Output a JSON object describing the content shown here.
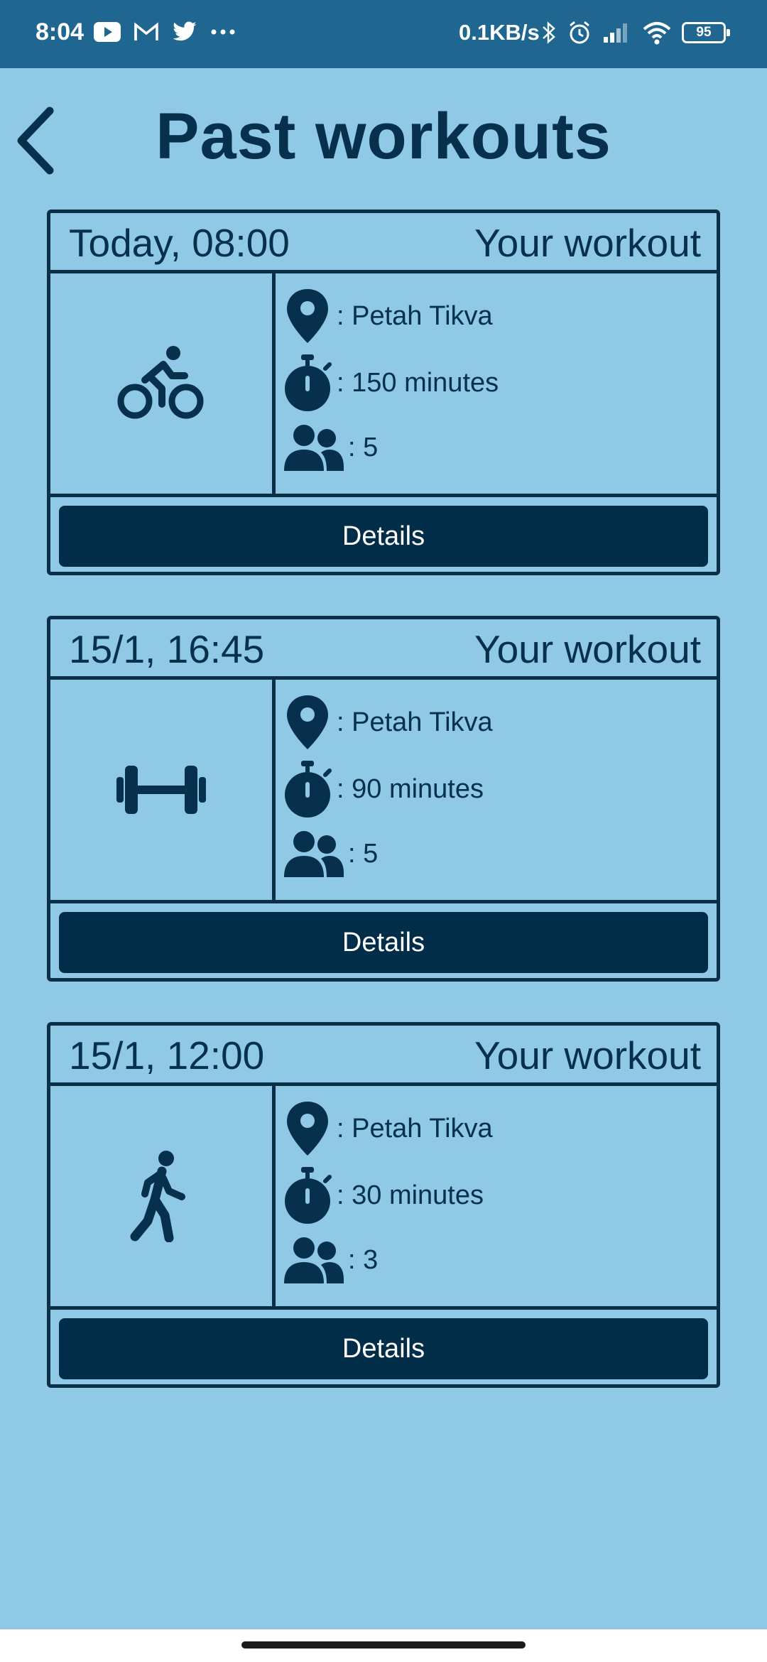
{
  "status_bar": {
    "time": "8:04",
    "left_icons": [
      "youtube-icon",
      "gmail-icon",
      "twitter-icon",
      "more-icon"
    ],
    "net_speed": "0.1KB/s",
    "right_icons": [
      "bluetooth-icon",
      "alarm-icon",
      "signal-icon",
      "wifi-icon"
    ],
    "battery": "95"
  },
  "header": {
    "title": "Past workouts",
    "back_icon": "back-chevron-icon"
  },
  "workouts": [
    {
      "date": "Today, 08:00",
      "label": "Your workout",
      "activity_icon": "cycling-icon",
      "location": ": Petah Tikva",
      "duration": ": 150 minutes",
      "participants": ": 5",
      "details_label": "Details"
    },
    {
      "date": "15/1, 16:45",
      "label": "Your workout",
      "activity_icon": "dumbbell-icon",
      "location": ": Petah Tikva",
      "duration": ": 90 minutes",
      "participants": ": 5",
      "details_label": "Details"
    },
    {
      "date": "15/1, 12:00",
      "label": "Your workout",
      "activity_icon": "walking-icon",
      "location": ": Petah Tikva",
      "duration": ": 30 minutes",
      "participants": ": 3",
      "details_label": "Details"
    }
  ],
  "colors": {
    "background": "#8fc9e6",
    "status_bar": "#1f6790",
    "dark": "#022d48",
    "text": "#06304b"
  }
}
